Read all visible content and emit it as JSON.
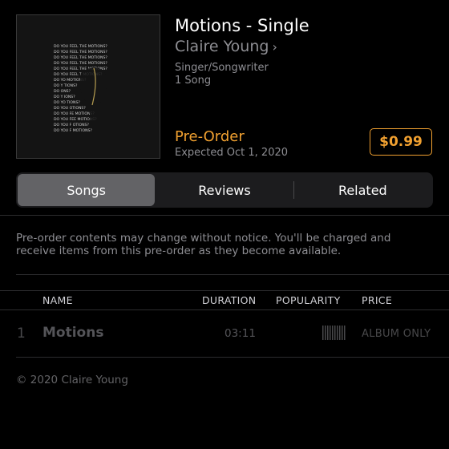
{
  "album": {
    "title": "Motions - Single",
    "artist": "Claire Young",
    "artist_chevron": "›",
    "genre": "Singer/Songwriter",
    "song_count": "1 Song",
    "artwork_text": "DO YOU FEEL THE MOTIONS?"
  },
  "preorder": {
    "label": "Pre-Order",
    "expected": "Expected Oct 1, 2020",
    "price": "$0.99"
  },
  "tabs": [
    {
      "label": "Songs",
      "active": true
    },
    {
      "label": "Reviews",
      "active": false
    },
    {
      "label": "Related",
      "active": false
    }
  ],
  "notice": "Pre-order contents may change without notice. You'll be charged and receive items from this pre-order as they become available.",
  "table": {
    "headers": {
      "name": "NAME",
      "duration": "DURATION",
      "popularity": "POPULARITY",
      "price": "PRICE"
    },
    "rows": [
      {
        "number": "1",
        "name": "Motions",
        "duration": "03:11",
        "popularity_icon": "popularity-bars-icon",
        "price": "ALBUM ONLY"
      }
    ]
  },
  "copyright": "© 2020 Claire Young",
  "colors": {
    "accent": "#f0a030",
    "background": "#000000",
    "secondary_text": "#8e8e93",
    "segment_bg": "#1c1c1e",
    "segment_active": "#636366"
  }
}
